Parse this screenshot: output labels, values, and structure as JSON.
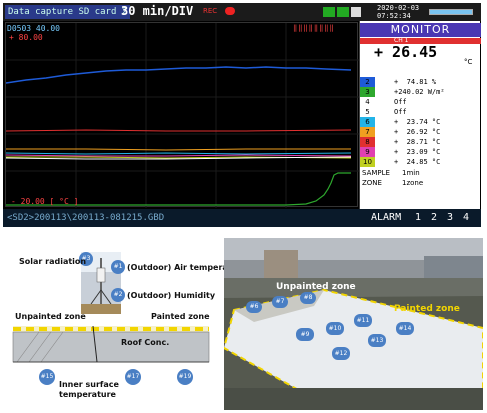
{
  "logger": {
    "title": "Data capture SD card 2",
    "time_div": "30  min/DIV",
    "rec_label": "REC",
    "datetime": "2020-02-03\n07:52:34",
    "y_top_label": "D0503 40.00",
    "y_top_value": "+ 80.00",
    "y_bottom": "- 20.00 [ °C ]",
    "marks": "‖‖‖‖‖‖‖‖",
    "status_path": "<SD2>200113\\200113-081215.GBD",
    "alarm_label": "ALARM",
    "alarm_nums": [
      "1",
      "2",
      "3",
      "4"
    ],
    "monitor_title": "MONITOR",
    "ch1_label": "CH 1",
    "big_value": "+  26.45",
    "big_unit": "°C",
    "channels": [
      {
        "n": "2",
        "val": "+  74.81 %",
        "color": "#1e5bd8"
      },
      {
        "n": "3",
        "val": "+240.02 W/m²",
        "color": "#2ea82e"
      },
      {
        "n": "4",
        "val": "Off",
        "color": "#ffffff"
      },
      {
        "n": "5",
        "val": "Off",
        "color": "#ffffff"
      },
      {
        "n": "6",
        "val": "+  23.74 °C",
        "color": "#23b4e8"
      },
      {
        "n": "7",
        "val": "+  26.92 °C",
        "color": "#f0a020"
      },
      {
        "n": "8",
        "val": "+  28.71 °C",
        "color": "#e03030"
      },
      {
        "n": "9",
        "val": "+  23.09 °C",
        "color": "#e040b0"
      },
      {
        "n": "10",
        "val": "+  24.85 °C",
        "color": "#c0d020"
      }
    ],
    "sample_label": "SAMPLE",
    "sample_value": "1min",
    "zone_label": "ZONE",
    "zone_value": "1zone",
    "trace_colors": [
      "#1e5bd8",
      "#e03030",
      "#23b4e8",
      "#f0a020",
      "#e040b0",
      "#c0d020",
      "#2ea82e",
      "#ffffff"
    ]
  },
  "diagram": {
    "solar_label": "Solar radiation",
    "air_temp_label": "(Outdoor) Air temperature",
    "humidity_label": "(Outdoor) Humidity",
    "unpainted_label": "Unpainted zone",
    "painted_label": "Painted zone",
    "roof_label": "Roof Conc.",
    "inner_label": "Inner surface\ntemperature",
    "sensor_ids": [
      "#3",
      "#1",
      "#2",
      "#15",
      "#17",
      "#19"
    ]
  },
  "photo": {
    "unpainted_label": "Unpainted zone",
    "painted_label": "Painted zone",
    "markers": [
      "#6",
      "#7",
      "#8",
      "#9",
      "#10",
      "#11",
      "#12",
      "#13",
      "#14"
    ]
  }
}
